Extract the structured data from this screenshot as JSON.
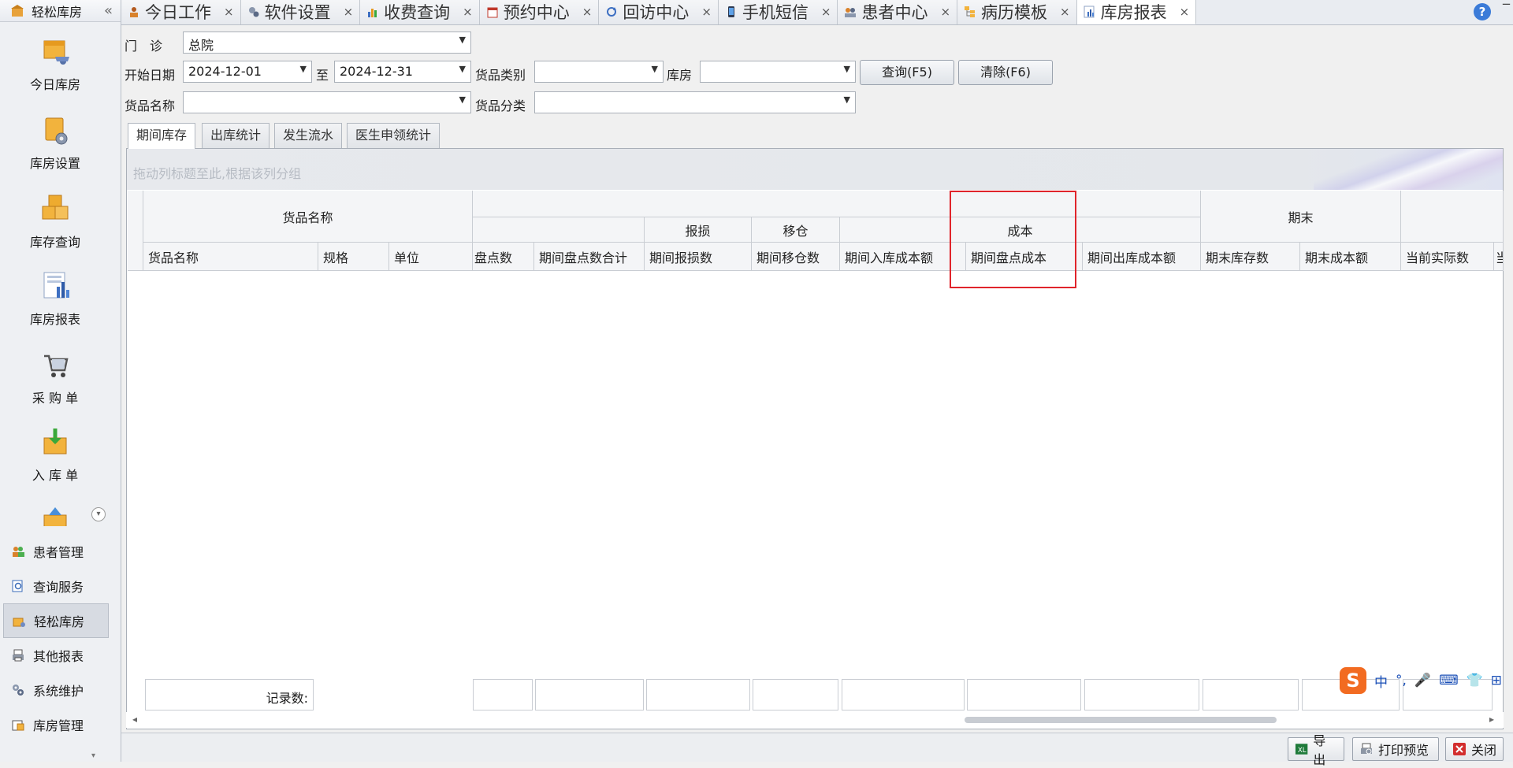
{
  "sidebar": {
    "title": "轻松库房",
    "collapse_icon": "double-chevron-left-icon",
    "big_items": [
      {
        "label": "今日库房",
        "icon": "box-cart-icon"
      },
      {
        "label": "库房设置",
        "icon": "box-gear-icon"
      },
      {
        "label": "库存查询",
        "icon": "boxes-icon"
      },
      {
        "label": "库房报表",
        "icon": "report-chart-icon"
      },
      {
        "label": "采 购 单",
        "icon": "shopping-cart-icon"
      },
      {
        "label": "入 库 单",
        "icon": "inbox-download-icon"
      }
    ],
    "nav_items": [
      {
        "label": "患者管理",
        "icon": "patients-icon"
      },
      {
        "label": "查询服务",
        "icon": "search-doc-icon"
      },
      {
        "label": "轻松库房",
        "icon": "warehouse-icon",
        "active": true
      },
      {
        "label": "其他报表",
        "icon": "printer-icon"
      },
      {
        "label": "系统维护",
        "icon": "gears-icon"
      },
      {
        "label": "库房管理",
        "icon": "warehouse-manage-icon"
      }
    ]
  },
  "tabs": [
    {
      "label": "今日工作",
      "close": "×"
    },
    {
      "label": "软件设置",
      "close": "×"
    },
    {
      "label": "收费查询",
      "close": "×"
    },
    {
      "label": "预约中心",
      "close": "×"
    },
    {
      "label": "回访中心",
      "close": "×"
    },
    {
      "label": "手机短信",
      "close": "×"
    },
    {
      "label": "患者中心",
      "close": "×"
    },
    {
      "label": "病历模板",
      "close": "×"
    },
    {
      "label": "库房报表",
      "close": "×",
      "active": true
    }
  ],
  "help_label": "?",
  "filters": {
    "clinic_label": "门　诊",
    "clinic_value": "总院",
    "start_label": "开始日期",
    "start_value": "2024-12-01",
    "to_label": "至",
    "end_value": "2024-12-31",
    "category_label": "货品类别",
    "category_value": "",
    "warehouse_label": "库房",
    "warehouse_value": "",
    "name_label": "货品名称",
    "name_value": "",
    "class_label": "货品分类",
    "class_value": "",
    "query_button": "查询(F5)",
    "clear_button": "清除(F6)"
  },
  "inner_tabs": [
    "期间库存",
    "出库统计",
    "发生流水",
    "医生申领统计"
  ],
  "grid": {
    "group_hint": "拖动列标题至此,根据该列分组",
    "band_top": [
      "货品名称",
      "",
      "期末"
    ],
    "band_mid": [
      "",
      "报损",
      "移仓",
      "成本"
    ],
    "columns": [
      "货品名称",
      "规格",
      "单位",
      "盘点数",
      "期间盘点数合计",
      "期间报损数",
      "期间移仓数",
      "期间入库成本额",
      "期间盘点成本",
      "期间出库成本额",
      "期末库存数",
      "期末成本额",
      "当前实际数",
      "当"
    ],
    "footer_label": "记录数:"
  },
  "status_buttons": [
    {
      "label": "导出",
      "icon": "excel-icon"
    },
    {
      "label": "打印预览",
      "icon": "print-preview-icon"
    },
    {
      "label": "关闭",
      "icon": "close-red-icon"
    }
  ],
  "ime": {
    "logo": "S",
    "items": [
      "中",
      "°,",
      "🎤",
      "⌨",
      "👕",
      "⊞"
    ]
  }
}
